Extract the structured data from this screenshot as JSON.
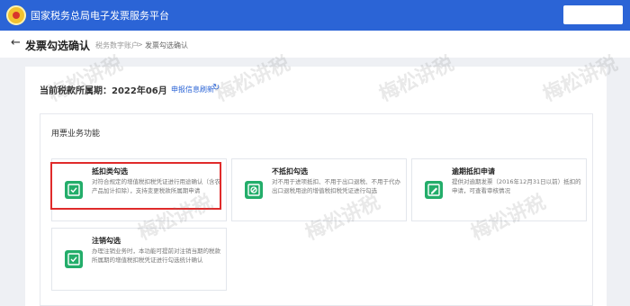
{
  "app": {
    "title": "国家税务总局电子发票服务平台"
  },
  "nav": {
    "back_icon": "arrow-left-icon",
    "page_title": "发票勾选确认",
    "breadcrumb": [
      "税务数字账户",
      ">",
      "发票勾选确认"
    ]
  },
  "period": {
    "label": "当前税款所属期：2022年06月",
    "refresh_link": "申报信息刷新",
    "refresh_icon": "refresh-icon"
  },
  "functions": {
    "heading": "用票业务功能",
    "cards": [
      {
        "title": "抵扣类勾选",
        "desc": "对符合规定的增值税扣税凭证进行用途确认（含农产品加计扣除），支持变更税款所属期申请",
        "icon": "check-document-icon"
      },
      {
        "title": "不抵扣勾选",
        "desc": "对不用于进项抵扣、不用于出口退税、不用于代办出口退税用途的增值税扣税凭证进行勾选",
        "icon": "block-document-icon"
      },
      {
        "title": "逾期抵扣申请",
        "desc": "提供对逾期发票（2016年12月31日以前）抵扣的申请，可查看审核情况",
        "icon": "edit-document-icon"
      },
      {
        "title": "注销勾选",
        "desc": "办理注销业务时，本功能可提前对注销当期的税款所属期的增值税扣税凭证进行勾选统计确认",
        "icon": "check-document-icon"
      }
    ]
  },
  "watermark": "梅松讲税",
  "colors": {
    "brand": "#2b64d6",
    "icon_green": "#23ad6a",
    "highlight": "#e02b2b"
  }
}
